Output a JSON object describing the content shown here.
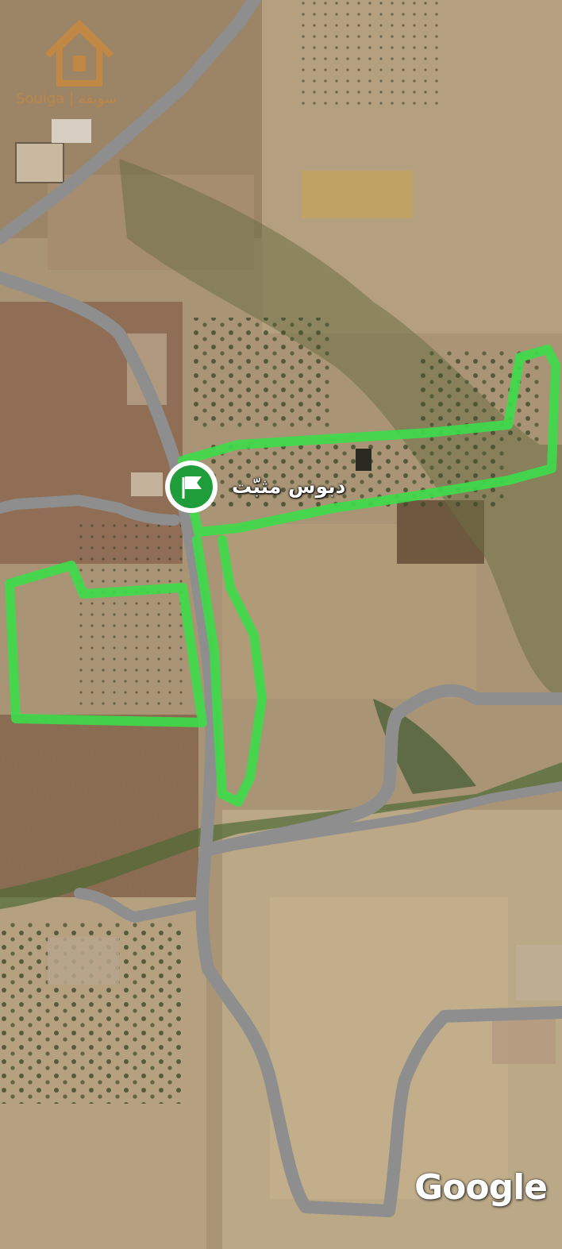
{
  "map": {
    "pin": {
      "label": "دبوس مثبّت",
      "icon": "flag-pin-icon",
      "color": "#1f9d3a"
    },
    "attribution": "Google",
    "watermark": {
      "text": "سويقة | Souiga",
      "icon": "house-logo-icon",
      "color": "#e08a2a"
    },
    "colors": {
      "road": "#8e8e8e",
      "parcel_outline": "#3ddc4a"
    }
  }
}
